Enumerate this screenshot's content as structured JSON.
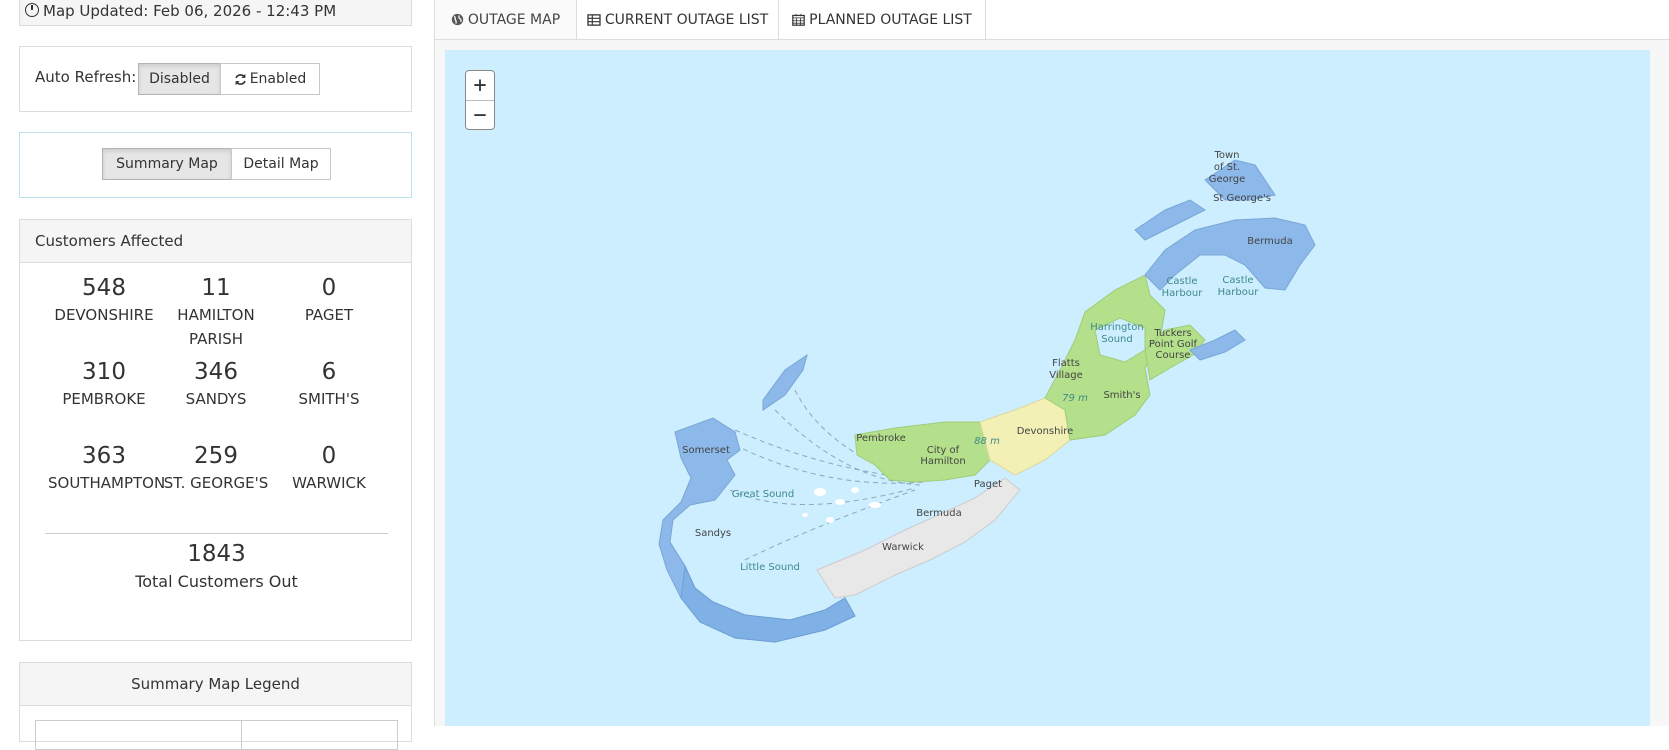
{
  "header": {
    "map_updated": "Map Updated: Feb 06, 2026 - 12:43 PM"
  },
  "auto_refresh": {
    "label": "Auto Refresh:",
    "disabled_label": "Disabled",
    "enabled_label": "Enabled",
    "selected": "Disabled"
  },
  "map_type": {
    "summary_label": "Summary Map",
    "detail_label": "Detail Map",
    "selected": "Summary Map"
  },
  "customers": {
    "title": "Customers Affected",
    "parishes": [
      {
        "count": "548",
        "name": "DEVONSHIRE"
      },
      {
        "count": "11",
        "name": "HAMILTON PARISH"
      },
      {
        "count": "0",
        "name": "PAGET"
      },
      {
        "count": "310",
        "name": "PEMBROKE"
      },
      {
        "count": "346",
        "name": "SANDYS"
      },
      {
        "count": "6",
        "name": "SMITH'S"
      },
      {
        "count": "363",
        "name": "SOUTHAMPTON"
      },
      {
        "count": "259",
        "name": "ST. GEORGE'S"
      },
      {
        "count": "0",
        "name": "WARWICK"
      }
    ],
    "total": "1843",
    "total_label": "Total Customers Out"
  },
  "legend": {
    "title": "Summary Map Legend"
  },
  "tabs": [
    {
      "label": "OUTAGE MAP",
      "icon": "globe-icon",
      "active": true
    },
    {
      "label": "CURRENT OUTAGE LIST",
      "icon": "table-icon",
      "active": false
    },
    {
      "label": "PLANNED OUTAGE LIST",
      "icon": "calendar-icon",
      "active": false
    }
  ],
  "map": {
    "zoom_in": "+",
    "zoom_out": "−",
    "colors": {
      "water": "#cdeefe",
      "blue": "#8db8ea",
      "green": "#b4e08c",
      "yellow": "#f2f0b4",
      "gray": "#e8e8e8"
    },
    "labels": {
      "town_st_george_1": "Town",
      "town_st_george_2": "of St.",
      "town_st_george_3": "George",
      "st_georges": "St George's",
      "bermuda_ne": "Bermuda",
      "castle_harbour_1": "Castle",
      "castle_harbour_2": "Harbour",
      "castle_harbour_3": "Castle",
      "castle_harbour_4": "Harbour",
      "harrington_1": "Harrington",
      "harrington_2": "Sound",
      "tuckers_1": "Tuckers",
      "tuckers_2": "Point Golf",
      "tuckers_3": "Course",
      "flatts_1": "Flatts",
      "flatts_2": "Village",
      "elev_79": "79 m",
      "smiths": "Smith's",
      "devonshire": "Devonshire",
      "elev_88": "88 m",
      "pembroke": "Pembroke",
      "city_hamilton_1": "City of",
      "city_hamilton_2": "Hamilton",
      "somerset": "Somerset",
      "great_sound": "Great Sound",
      "paget": "Paget",
      "bermuda_sw": "Bermuda",
      "warwick": "Warwick",
      "sandys": "Sandys",
      "little_sound": "Little Sound"
    }
  }
}
